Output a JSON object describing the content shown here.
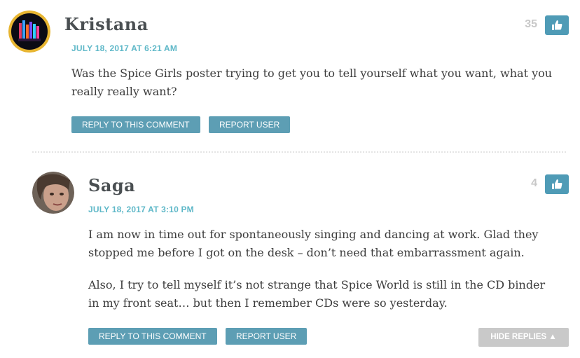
{
  "comments": [
    {
      "author": "Kristana",
      "date": "JULY 18, 2017 AT 6:21 AM",
      "score": "35",
      "paragraphs": [
        "Was the Spice Girls poster trying to get you to tell yourself what you want, what you really really want?"
      ],
      "reply_label": "REPLY TO THIS COMMENT",
      "report_label": "REPORT USER",
      "avatar_icon": "avatar-image"
    },
    {
      "author": "Saga",
      "date": "JULY 18, 2017 AT 3:10 PM",
      "score": "4",
      "paragraphs": [
        "I am now in time out for spontaneously singing and dancing at work. Glad they stopped me before I got on the desk – don’t need that embarrassment again.",
        "Also, I try to tell myself it’s not strange that Spice World is still in the CD binder in my front seat… but then I remember CDs were so yesterday."
      ],
      "reply_label": "REPLY TO THIS COMMENT",
      "report_label": "REPORT USER",
      "avatar_icon": "avatar-image"
    }
  ],
  "hide_replies_label": "HIDE REPLIES ▲",
  "icons": {
    "like": "thumbs-up-icon"
  },
  "colors": {
    "accent": "#5fb8c8",
    "button": "#5d9eb4",
    "like_button": "#4f9bb6",
    "hide_button": "#c9c9c9"
  }
}
